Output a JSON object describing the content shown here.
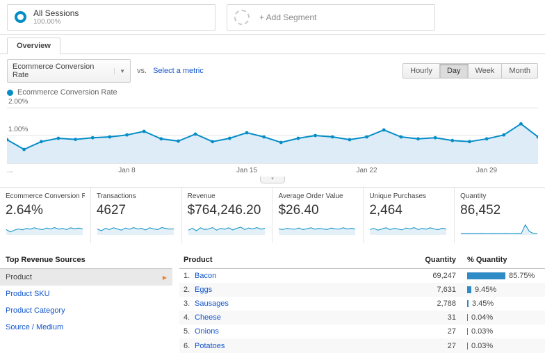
{
  "colors": {
    "accent": "#058dc7",
    "area_fill": "#ddecf7",
    "link": "#1155cc",
    "bar": "#2e8bc5"
  },
  "segments": {
    "all_sessions": {
      "label": "All Sessions",
      "value": "100.00%"
    },
    "add_segment": {
      "label": "+ Add Segment"
    }
  },
  "tabs": {
    "overview": "Overview"
  },
  "metric_selector": {
    "selected": "Ecommerce Conversion Rate",
    "vs_label": "vs.",
    "select_metric_label": "Select a metric",
    "granularity": [
      "Hourly",
      "Day",
      "Week",
      "Month"
    ],
    "granularity_selected": "Day"
  },
  "legend": {
    "label": "Ecommerce Conversion Rate"
  },
  "chart_data": {
    "type": "area",
    "title": "Ecommerce Conversion Rate",
    "ylim": [
      0,
      2
    ],
    "yticks": [
      "2.00%",
      "1.00%"
    ],
    "x_start_label": "...",
    "xticks": [
      "Jan 8",
      "Jan 15",
      "Jan 22",
      "Jan 29"
    ],
    "xtick_indices": [
      7,
      14,
      21,
      28
    ],
    "values": [
      0.85,
      0.5,
      0.78,
      0.9,
      0.86,
      0.92,
      0.95,
      1.02,
      1.15,
      0.88,
      0.8,
      1.05,
      0.78,
      0.9,
      1.1,
      0.95,
      0.75,
      0.9,
      1.0,
      0.95,
      0.85,
      0.95,
      1.2,
      0.95,
      0.88,
      0.92,
      0.82,
      0.78,
      0.88,
      1.02,
      1.42,
      0.95
    ]
  },
  "scorecards": [
    {
      "label": "Ecommerce Conversion Rate",
      "value": "2.64%",
      "sparkline": [
        0.45,
        0.25,
        0.4,
        0.5,
        0.42,
        0.55,
        0.48,
        0.6,
        0.5,
        0.44,
        0.58,
        0.5,
        0.62,
        0.48,
        0.55,
        0.45,
        0.6,
        0.52,
        0.58,
        0.5
      ]
    },
    {
      "label": "Transactions",
      "value": "4627",
      "sparkline": [
        0.5,
        0.35,
        0.55,
        0.45,
        0.6,
        0.5,
        0.4,
        0.58,
        0.48,
        0.62,
        0.5,
        0.55,
        0.42,
        0.6,
        0.5,
        0.45,
        0.62,
        0.55,
        0.48,
        0.52
      ]
    },
    {
      "label": "Revenue",
      "value": "$764,246.20",
      "sparkline": [
        0.4,
        0.55,
        0.35,
        0.6,
        0.45,
        0.5,
        0.62,
        0.4,
        0.55,
        0.48,
        0.6,
        0.42,
        0.55,
        0.65,
        0.45,
        0.58,
        0.5,
        0.62,
        0.48,
        0.55
      ]
    },
    {
      "label": "Average Order Value",
      "value": "$26.40",
      "sparkline": [
        0.5,
        0.45,
        0.55,
        0.5,
        0.48,
        0.58,
        0.45,
        0.52,
        0.6,
        0.48,
        0.55,
        0.5,
        0.45,
        0.58,
        0.52,
        0.48,
        0.6,
        0.5,
        0.55,
        0.5
      ]
    },
    {
      "label": "Unique Purchases",
      "value": "2,464",
      "sparkline": [
        0.45,
        0.55,
        0.4,
        0.5,
        0.6,
        0.45,
        0.55,
        0.5,
        0.42,
        0.58,
        0.5,
        0.62,
        0.45,
        0.55,
        0.48,
        0.6,
        0.5,
        0.44,
        0.56,
        0.5
      ]
    },
    {
      "label": "Quantity",
      "value": "86,452",
      "sparkline": [
        0.1,
        0.1,
        0.11,
        0.1,
        0.1,
        0.11,
        0.1,
        0.1,
        0.11,
        0.1,
        0.1,
        0.11,
        0.1,
        0.1,
        0.11,
        0.1,
        0.85,
        0.3,
        0.12,
        0.1
      ]
    }
  ],
  "revenue_sources": {
    "title": "Top Revenue Sources",
    "items": [
      {
        "label": "Product",
        "selected": true
      },
      {
        "label": "Product SKU",
        "selected": false
      },
      {
        "label": "Product Category",
        "selected": false
      },
      {
        "label": "Source / Medium",
        "selected": false
      }
    ]
  },
  "product_table": {
    "columns": [
      "Product",
      "Quantity",
      "% Quantity"
    ],
    "rows": [
      {
        "rank": "1.",
        "product": "Bacon",
        "quantity": "69,247",
        "pct": "85.75%",
        "pct_value": 85.75
      },
      {
        "rank": "2.",
        "product": "Eggs",
        "quantity": "7,631",
        "pct": "9.45%",
        "pct_value": 9.45
      },
      {
        "rank": "3.",
        "product": "Sausages",
        "quantity": "2,788",
        "pct": "3.45%",
        "pct_value": 3.45
      },
      {
        "rank": "4.",
        "product": "Cheese",
        "quantity": "31",
        "pct": "0.04%",
        "pct_value": 0.04
      },
      {
        "rank": "5.",
        "product": "Onions",
        "quantity": "27",
        "pct": "0.03%",
        "pct_value": 0.03
      },
      {
        "rank": "6.",
        "product": "Potatoes",
        "quantity": "27",
        "pct": "0.03%",
        "pct_value": 0.03
      }
    ]
  }
}
